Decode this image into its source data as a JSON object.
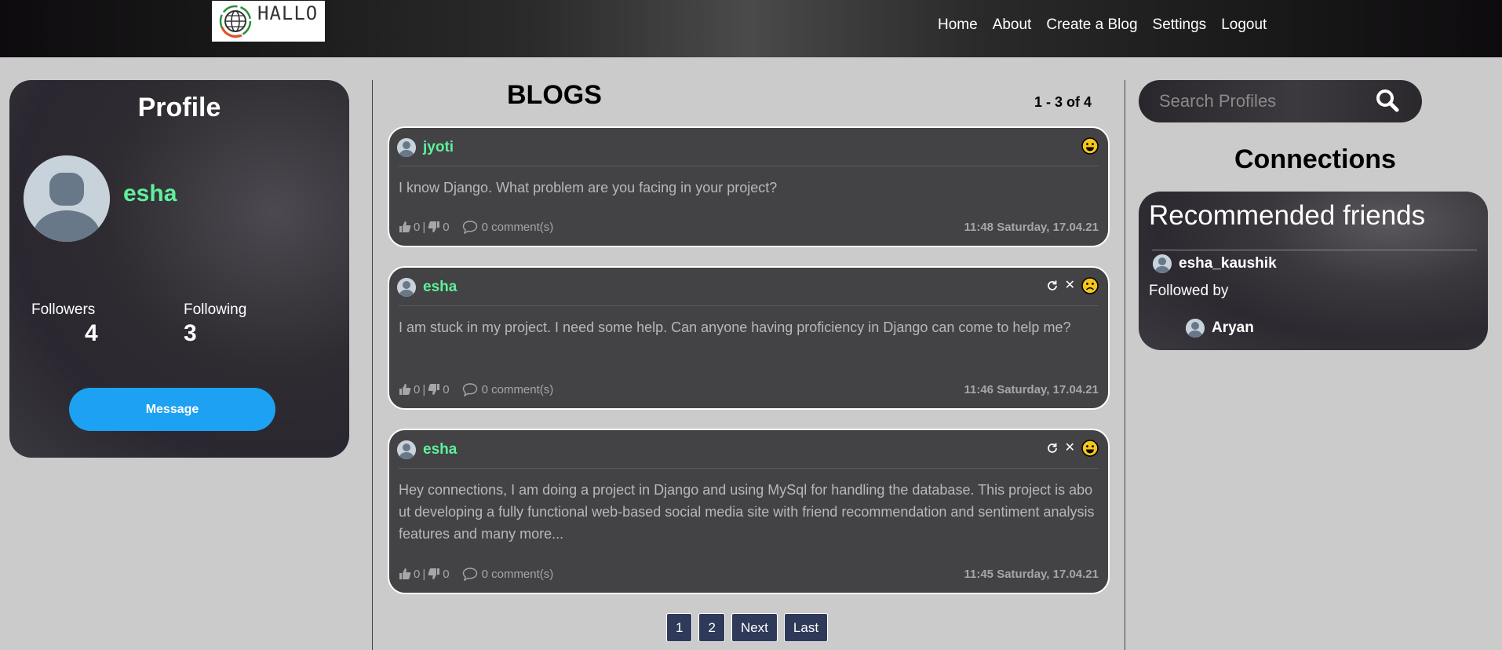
{
  "nav": {
    "logo_text": "HALLO",
    "links": [
      "Home",
      "About",
      "Create a Blog",
      "Settings",
      "Logout"
    ]
  },
  "profile": {
    "title": "Profile",
    "username": "esha",
    "followers_label": "Followers",
    "followers_count": "4",
    "following_label": "Following",
    "following_count": "3",
    "message_button": "Message"
  },
  "blogs": {
    "title": "BLOGS",
    "range_text": "1 - 3 of 4",
    "posts": [
      {
        "author": "jyoti",
        "text": "I know Django. What problem are you facing in your project?",
        "likes": "0",
        "dislikes": "0",
        "comments": "0 comment(s)",
        "time": "11:48 Saturday, 17.04.21",
        "sentiment": "happy-face-icon",
        "owner_actions": false
      },
      {
        "author": "esha",
        "text": "I am stuck in my project. I need some help. Can anyone having proficiency in Django can come to help me?",
        "likes": "0",
        "dislikes": "0",
        "comments": "0 comment(s)",
        "time": "11:46 Saturday, 17.04.21",
        "sentiment": "sad-face-icon",
        "owner_actions": true
      },
      {
        "author": "esha",
        "text": "Hey connections, I am doing a project in Django and using MySql for handling the database. This project is about developing a fully functional web-based social media site with friend recommendation and sentiment analysis features and many more...",
        "likes": "0",
        "dislikes": "0",
        "comments": "0 comment(s)",
        "time": "11:45 Saturday, 17.04.21",
        "sentiment": "happy-face-icon",
        "owner_actions": true
      }
    ],
    "pagination": [
      "1",
      "2",
      "Next",
      "Last"
    ]
  },
  "search": {
    "placeholder": "Search Profiles"
  },
  "connections": {
    "title": "Connections",
    "recommended_title": "Recommended friends",
    "recommended_user": "esha_kaushik",
    "followed_by_label": "Followed by",
    "followed_by_user": "Aryan"
  },
  "colors": {
    "accent_green": "#5ef09a",
    "message_blue": "#1da1f2",
    "page_bg": "#cbcbcb",
    "card_dark": "#434345",
    "pagination_bg": "#2f3a5a"
  }
}
